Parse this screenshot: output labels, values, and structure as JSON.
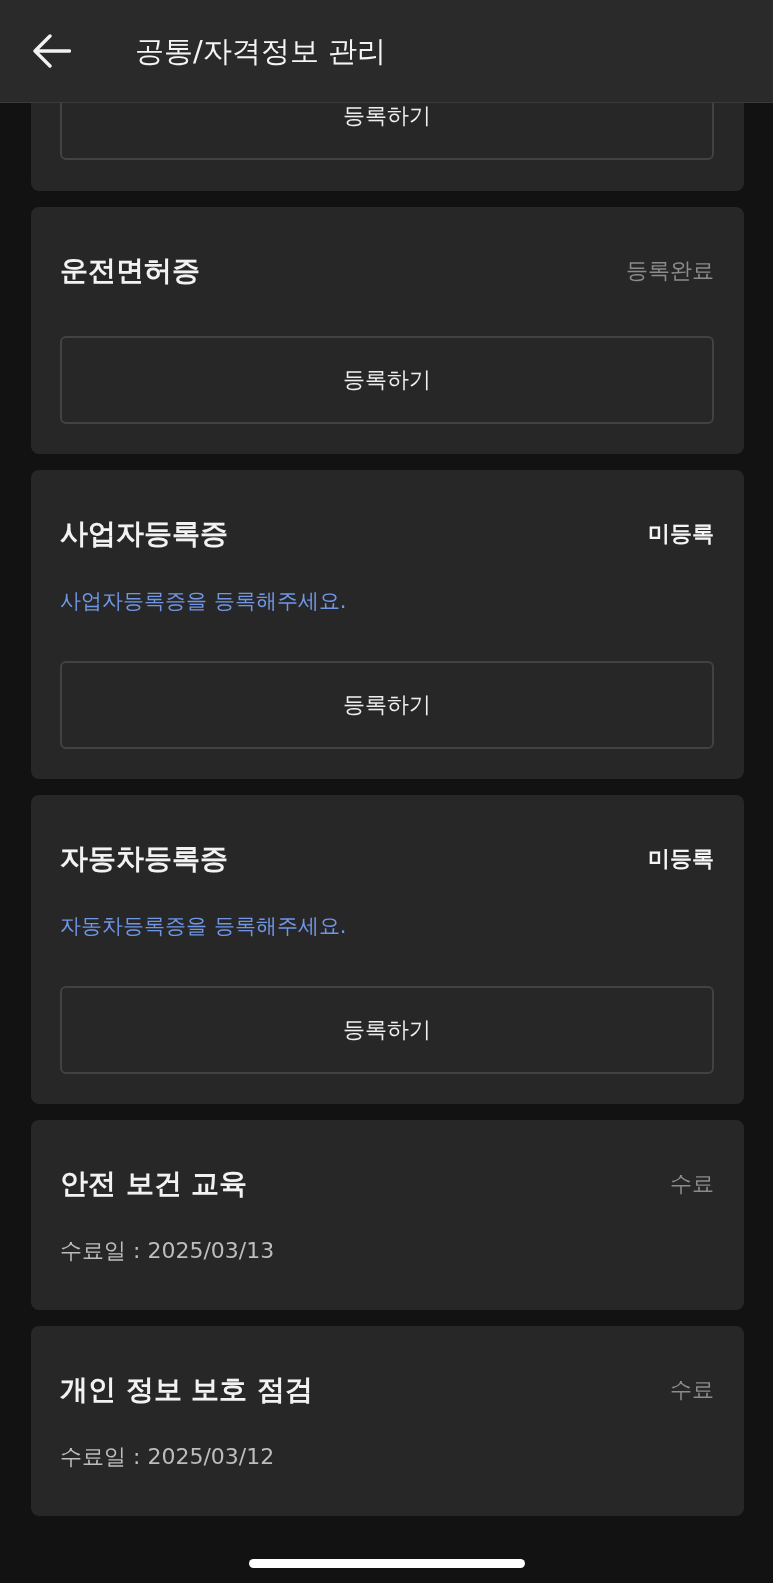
{
  "header": {
    "title": "공통/자격정보 관리"
  },
  "cards": [
    {
      "button": "등록하기"
    },
    {
      "title": "운전면허증",
      "status": {
        "text": "등록완료",
        "kind": "complete"
      },
      "button": "등록하기"
    },
    {
      "title": "사업자등록증",
      "status": {
        "text": "미등록",
        "kind": "missing"
      },
      "description": "사업자등록증을 등록해주세요.",
      "button": "등록하기"
    },
    {
      "title": "자동차등록증",
      "status": {
        "text": "미등록",
        "kind": "missing"
      },
      "description": "자동차등록증을 등록해주세요.",
      "button": "등록하기"
    },
    {
      "title": "안전 보건 교육",
      "status": {
        "text": "수료",
        "kind": "complete"
      },
      "date": "수료일 : 2025/03/13"
    },
    {
      "title": "개인 정보 보호 점검",
      "status": {
        "text": "수료",
        "kind": "complete"
      },
      "date": "수료일 : 2025/03/12"
    }
  ]
}
